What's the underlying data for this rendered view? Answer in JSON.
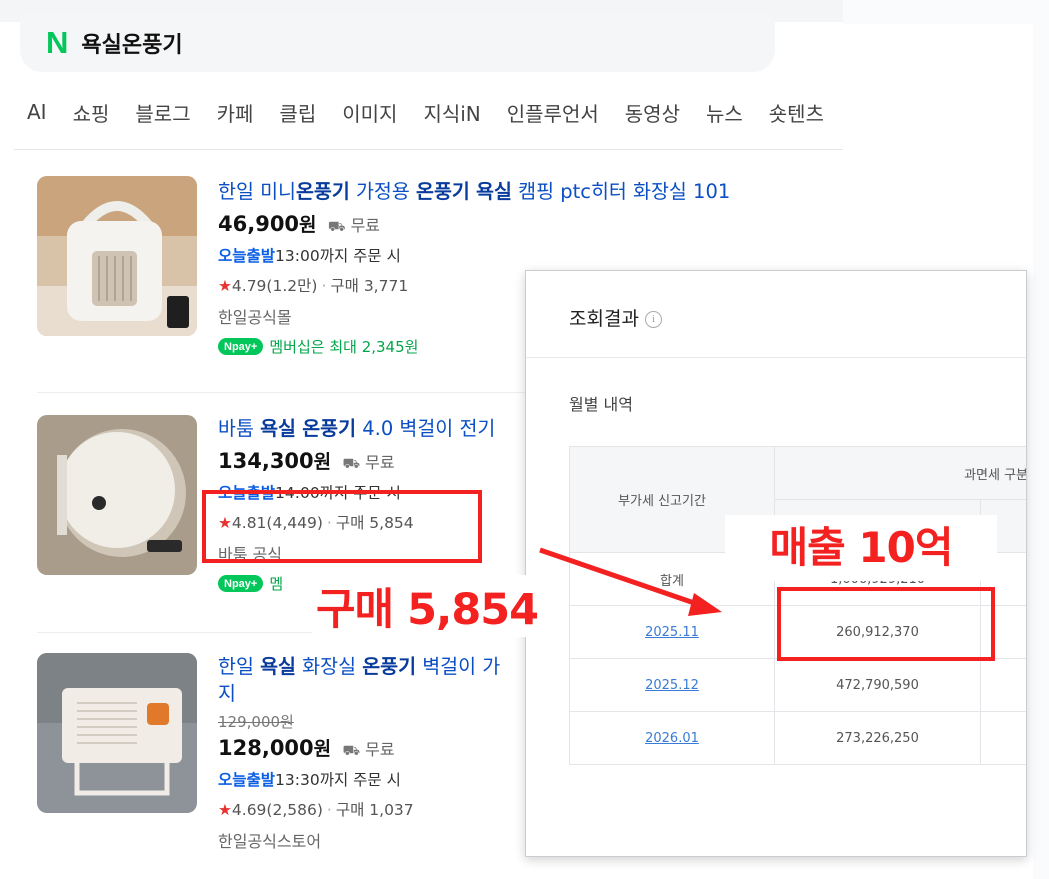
{
  "search": {
    "logo": "N",
    "query": "욕실온풍기"
  },
  "tabs": [
    "AI",
    "쇼핑",
    "블로그",
    "카페",
    "클립",
    "이미지",
    "지식iN",
    "인플루언서",
    "동영상",
    "뉴스",
    "숏텐츠"
  ],
  "products": [
    {
      "title_parts": [
        "한일 미니",
        "온풍기",
        " 가정용 ",
        "온풍기",
        " ",
        "욕실",
        " 캠핑 ptc히터 화장실 101"
      ],
      "price": "46,900",
      "won": "원",
      "shipping": "무료",
      "delivery_badge": "오늘출발",
      "delivery_text": "13:00까지 주문 시",
      "rating": "4.79",
      "reviews": "(1.2만)",
      "purchases": "구매 3,771",
      "store": "한일공식몰",
      "npay": "pay",
      "member": "멤버십은 최대 2,345원"
    },
    {
      "title_parts": [
        "바툼 ",
        "욕실",
        " ",
        "온풍기",
        " 4.0 벽걸이 전기"
      ],
      "price": "134,300",
      "won": "원",
      "shipping": "무료",
      "delivery_badge": "오늘출발",
      "delivery_text": "14:00까지 주문 시",
      "rating": "4.81",
      "reviews": "(4,449)",
      "purchases": "구매 5,854",
      "store": "바툼 공식",
      "npay": "pay",
      "member": "멤"
    },
    {
      "title_parts": [
        "한일 ",
        "욕실",
        " 화장실 ",
        "온풍기",
        " 벽걸이 가"
      ],
      "title_line2": "지",
      "original_price": "129,000원",
      "price": "128,000",
      "won": "원",
      "shipping": "무료",
      "delivery_badge": "오늘출발",
      "delivery_text": "13:30까지 주문 시",
      "rating": "4.69",
      "reviews": "(2,586)",
      "purchases": "구매 1,037",
      "store": "한일공식스토어"
    }
  ],
  "popup": {
    "title": "조회결과",
    "info_icon": "i",
    "monthly_label": "월별 내역",
    "col_header": "과면세 구분",
    "row_header": "부가세 신고기간",
    "rows": [
      {
        "period": "합계",
        "amount": "1,006,929,210",
        "link": false
      },
      {
        "period": "2025.11",
        "amount": "260,912,370",
        "link": true
      },
      {
        "period": "2025.12",
        "amount": "472,790,590",
        "link": true
      },
      {
        "period": "2026.01",
        "amount": "273,226,250",
        "link": true
      }
    ]
  },
  "annotations": {
    "purchase_label": "구매 5,854",
    "sales_label": "매출 10억",
    "color": "#f42121"
  }
}
